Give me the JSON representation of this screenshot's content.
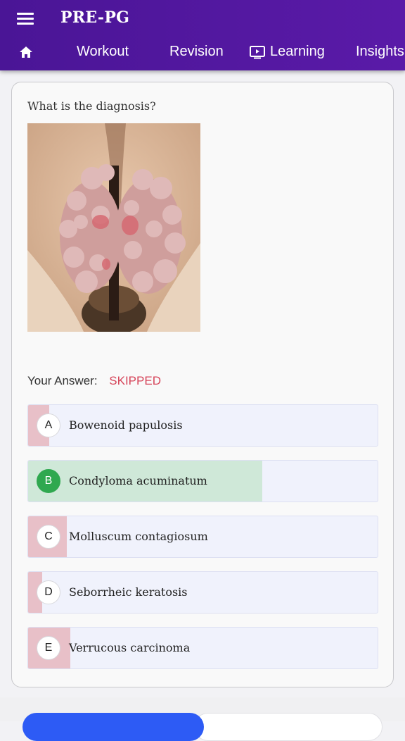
{
  "app": {
    "title": "PRE-PG"
  },
  "nav": {
    "workout": "Workout",
    "revision": "Revision",
    "learning": "Learning",
    "insights": "Insights"
  },
  "question": {
    "text": "What is the diagnosis?",
    "your_answer_label": "Your Answer:",
    "your_answer_value": "SKIPPED"
  },
  "options": [
    {
      "letter": "A",
      "text": "Bowenoid papulosis",
      "percent": 6,
      "correct": false
    },
    {
      "letter": "B",
      "text": "Condyloma acuminatum",
      "percent": 67,
      "correct": true
    },
    {
      "letter": "C",
      "text": "Molluscum contagiosum",
      "percent": 11,
      "correct": false
    },
    {
      "letter": "D",
      "text": "Seborrheic keratosis",
      "percent": 4,
      "correct": false
    },
    {
      "letter": "E",
      "text": "Verrucous carcinoma",
      "percent": 12,
      "correct": false
    }
  ],
  "colors": {
    "appbar": "#4a1596",
    "correct_fill": "#cfe8d8",
    "wrong_fill": "#e8c0c8",
    "correct_badge": "#2fa84f",
    "skipped": "#d6455a",
    "primary_button": "#2d5bf5"
  },
  "icons": {
    "menu": "hamburger-icon",
    "home": "home-icon",
    "learning": "tv-play-icon"
  }
}
